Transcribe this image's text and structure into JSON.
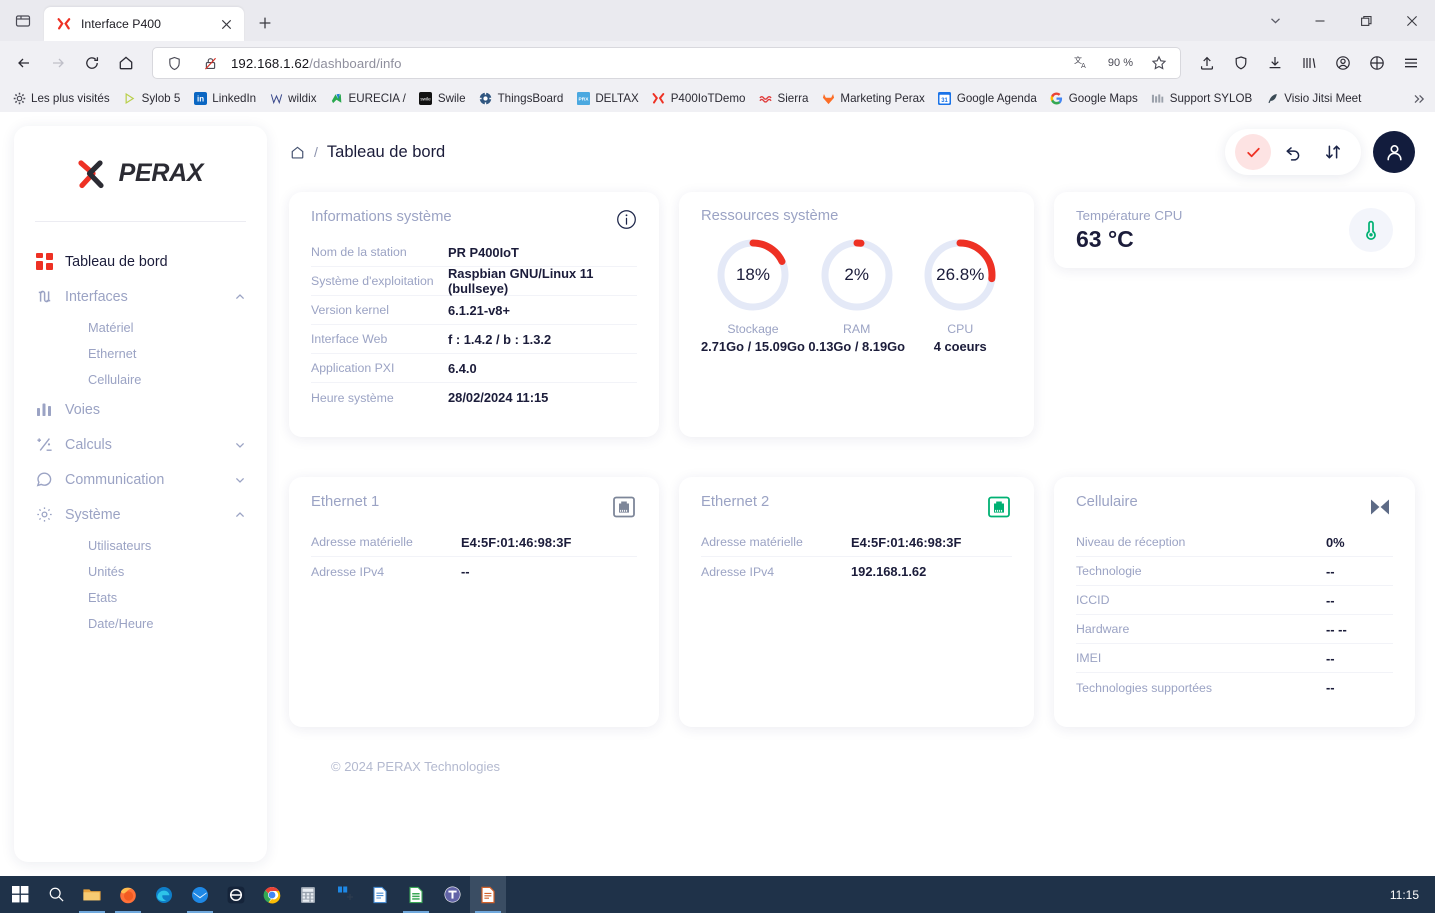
{
  "browser": {
    "tab": {
      "title": "Interface P400",
      "favicon": "perax-x-icon"
    },
    "url_host": "192.168.1.62",
    "url_path": "/dashboard/info",
    "zoom": "90 %",
    "bookmarks": [
      {
        "label": "Les plus visités",
        "icon": "gear-icon"
      },
      {
        "label": "Sylob 5",
        "icon": "play-triangle-icon"
      },
      {
        "label": "LinkedIn",
        "icon": "linkedin-icon"
      },
      {
        "label": "wildix",
        "icon": "w-icon"
      },
      {
        "label": "EURECIA /",
        "icon": "eurecia-icon"
      },
      {
        "label": "Swile",
        "icon": "swile-icon"
      },
      {
        "label": "ThingsBoard",
        "icon": "thingsboard-icon"
      },
      {
        "label": "DELTAX",
        "icon": "prx-icon"
      },
      {
        "label": "P400IoTDemo",
        "icon": "perax-x-icon"
      },
      {
        "label": "Sierra",
        "icon": "sierra-icon"
      },
      {
        "label": "Marketing Perax",
        "icon": "gitlab-icon"
      },
      {
        "label": "Google Agenda",
        "icon": "calendar-31-icon"
      },
      {
        "label": "Google Maps",
        "icon": "google-g-icon"
      },
      {
        "label": "Support SYLOB",
        "icon": "bars-icon"
      },
      {
        "label": "Visio Jitsi Meet",
        "icon": "jitsi-icon"
      }
    ]
  },
  "sidebar": {
    "logo_text": "PERAX",
    "items": [
      {
        "label": "Tableau de bord",
        "icon": "dashboard-grid-icon",
        "active": true,
        "expandable": false
      },
      {
        "label": "Interfaces",
        "icon": "interfaces-icon",
        "active": false,
        "expandable": true,
        "expanded": true,
        "children": [
          {
            "label": "Matériel"
          },
          {
            "label": "Ethernet"
          },
          {
            "label": "Cellulaire"
          }
        ]
      },
      {
        "label": "Voies",
        "icon": "chart-bars-icon",
        "active": false,
        "expandable": false
      },
      {
        "label": "Calculs",
        "icon": "math-icon",
        "active": false,
        "expandable": true,
        "expanded": false
      },
      {
        "label": "Communication",
        "icon": "chat-bubble-icon",
        "active": false,
        "expandable": true,
        "expanded": false
      },
      {
        "label": "Système",
        "icon": "gear-icon",
        "active": false,
        "expandable": true,
        "expanded": true,
        "children": [
          {
            "label": "Utilisateurs"
          },
          {
            "label": "Unités"
          },
          {
            "label": "Etats"
          },
          {
            "label": "Date/Heure"
          }
        ]
      }
    ]
  },
  "topbar": {
    "breadcrumb_home": "home-icon",
    "breadcrumb_sep": "/",
    "breadcrumb_current": "Tableau de bord",
    "actions": [
      {
        "name": "validate-button",
        "icon": "check-icon"
      },
      {
        "name": "undo-button",
        "icon": "undo-arrow-icon"
      },
      {
        "name": "sort-button",
        "icon": "up-down-arrows-icon"
      }
    ],
    "avatar_icon": "user-icon"
  },
  "cards": {
    "system_info": {
      "title": "Informations système",
      "info_icon": "info-circle-icon",
      "rows": [
        {
          "key": "Nom de la station",
          "value": "PR P400IoT"
        },
        {
          "key": "Système d'exploitation",
          "value": "Raspbian GNU/Linux 11 (bullseye)"
        },
        {
          "key": "Version kernel",
          "value": "6.1.21-v8+"
        },
        {
          "key": "Interface Web",
          "value": "f : 1.4.2 / b : 1.3.2"
        },
        {
          "key": "Application PXI",
          "value": "6.4.0"
        },
        {
          "key": "Heure système",
          "value": "28/02/2024 11:15"
        }
      ]
    },
    "resources": {
      "title": "Ressources système",
      "gauges": [
        {
          "label": "Stockage",
          "percent": 18,
          "display": "18%",
          "sub": "2.71Go / 15.09Go"
        },
        {
          "label": "RAM",
          "percent": 2,
          "display": "2%",
          "sub": "0.13Go / 8.19Go"
        },
        {
          "label": "CPU",
          "percent": 26.8,
          "display": "26.8%",
          "sub": "4 coeurs"
        }
      ]
    },
    "temperature": {
      "title": "Température CPU",
      "value": "63 °C",
      "icon": "thermometer-icon"
    },
    "ethernet1": {
      "title": "Ethernet 1",
      "icon": "rj45-port-icon",
      "status": "disconnected",
      "rows": [
        {
          "key": "Adresse matérielle",
          "value": "E4:5F:01:46:98:3F"
        },
        {
          "key": "Adresse IPv4",
          "value": "--"
        }
      ]
    },
    "ethernet2": {
      "title": "Ethernet 2",
      "icon": "rj45-port-icon",
      "status": "connected",
      "rows": [
        {
          "key": "Adresse matérielle",
          "value": "E4:5F:01:46:98:3F"
        },
        {
          "key": "Adresse IPv4",
          "value": "192.168.1.62"
        }
      ]
    },
    "cellular": {
      "title": "Cellulaire",
      "icon": "no-signal-icon",
      "rows": [
        {
          "key": "Niveau de réception",
          "value": "0%"
        },
        {
          "key": "Technologie",
          "value": "--"
        },
        {
          "key": "ICCID",
          "value": "--"
        },
        {
          "key": "Hardware",
          "value": "-- --"
        },
        {
          "key": "IMEI",
          "value": "--"
        },
        {
          "key": "Technologies supportées",
          "value": "--"
        }
      ]
    }
  },
  "footer": {
    "text": "© 2024 PERAX Technologies"
  },
  "taskbar": {
    "clock": "11:15",
    "items": [
      {
        "icon": "windows-start-icon",
        "running": false
      },
      {
        "icon": "search-icon",
        "running": false
      },
      {
        "icon": "file-explorer-icon",
        "running": true
      },
      {
        "icon": "firefox-icon",
        "running": true
      },
      {
        "icon": "edge-icon",
        "running": false
      },
      {
        "icon": "thunderbird-icon",
        "running": true
      },
      {
        "icon": "anydesk-icon",
        "running": false
      },
      {
        "icon": "chrome-icon",
        "running": false
      },
      {
        "icon": "calculator-icon",
        "running": false
      },
      {
        "icon": "app-icon",
        "running": false
      },
      {
        "icon": "word-doc-icon",
        "running": false
      },
      {
        "icon": "excel-sheet-icon",
        "running": true
      },
      {
        "icon": "teams-icon",
        "running": false
      },
      {
        "icon": "writer-doc-icon",
        "running": true
      }
    ]
  },
  "colors": {
    "accent_red": "#ee3124",
    "gauge_track": "#e4e9f7",
    "navy": "#1b1c3a",
    "muted": "#9ba3c4",
    "green": "#00b173"
  }
}
